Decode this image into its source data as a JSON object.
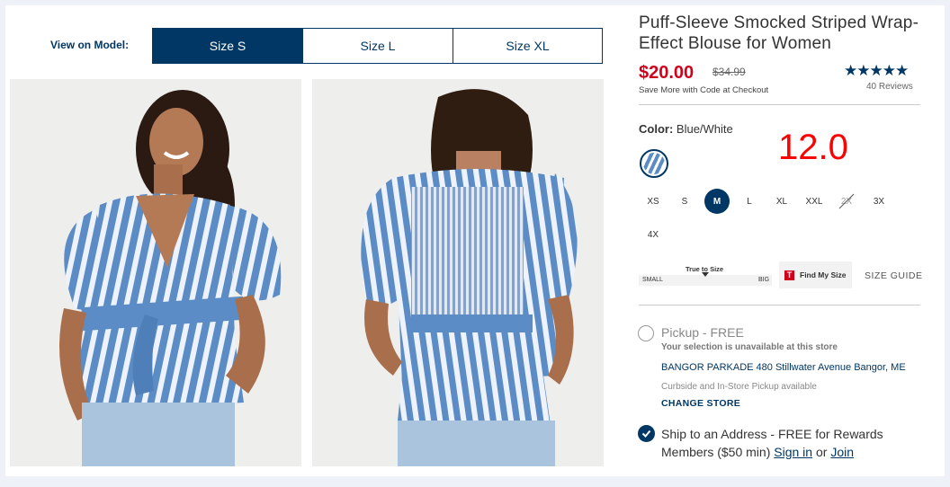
{
  "view_on_model": {
    "label": "View on Model:",
    "options": [
      "Size S",
      "Size L",
      "Size XL"
    ],
    "selected": "Size S"
  },
  "product": {
    "title": "Puff-Sleeve Smocked Striped Wrap-Effect Blouse for Women",
    "price": "$20.00",
    "original_price": "$34.99",
    "promo": "Save More with Code at Checkout",
    "rating_stars": "★★★★★",
    "rating_value": 4.5,
    "reviews": "40 Reviews"
  },
  "color": {
    "label": "Color:",
    "value": "Blue/White",
    "swatch_icon": "striped-swatch"
  },
  "annotation": "12.0",
  "sizes": [
    {
      "label": "XS",
      "state": "available"
    },
    {
      "label": "S",
      "state": "available"
    },
    {
      "label": "M",
      "state": "selected"
    },
    {
      "label": "L",
      "state": "available"
    },
    {
      "label": "XL",
      "state": "available"
    },
    {
      "label": "XXL",
      "state": "available"
    },
    {
      "label": "2X",
      "state": "unavailable"
    },
    {
      "label": "3X",
      "state": "available"
    },
    {
      "label": "4X",
      "state": "available"
    }
  ],
  "fit": {
    "title": "True to Size",
    "small": "SMALL",
    "big": "BIG",
    "find_my_size": "Find My Size",
    "find_my_size_logo": "T",
    "size_guide": "SIZE GUIDE"
  },
  "fulfillment": {
    "pickup_label": "Pickup - FREE",
    "unavailable": "Your selection is unavailable at this store",
    "store": "BANGOR PARKADE 480 Stillwater Avenue  Bangor, ME",
    "curbside": "Curbside and In-Store Pickup available",
    "change_store": "CHANGE STORE",
    "ship_text_1": "Ship to an Address - FREE for Rewards Members ($50 min)",
    "sign_in": "Sign in",
    "or": "or",
    "join": "Join"
  },
  "colors": {
    "navy": "#003764",
    "sale_red": "#d0021b",
    "annotation_red": "#ff0000",
    "stripe_blue": "#5b8cc6"
  }
}
